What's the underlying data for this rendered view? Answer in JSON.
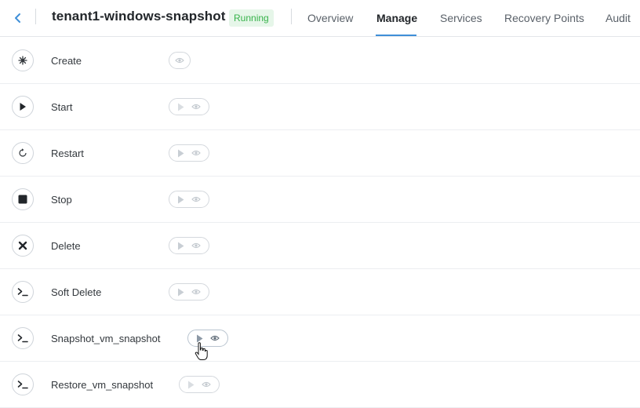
{
  "header": {
    "title": "tenant1-windows-snapshot",
    "status": "Running",
    "accent_color": "#3f8fd8",
    "status_color": "#36b24a",
    "tabs": [
      {
        "label": "Overview",
        "active": false
      },
      {
        "label": "Manage",
        "active": true
      },
      {
        "label": "Services",
        "active": false
      },
      {
        "label": "Recovery Points",
        "active": false
      },
      {
        "label": "Audit",
        "active": false
      }
    ]
  },
  "actions": [
    {
      "label": "Create",
      "icon": "sparkle-icon",
      "buttons": [
        "view"
      ],
      "enabled": true
    },
    {
      "label": "Start",
      "icon": "play-icon",
      "buttons": [
        "run",
        "view"
      ],
      "enabled": false
    },
    {
      "label": "Restart",
      "icon": "restart-icon",
      "buttons": [
        "run",
        "view"
      ],
      "enabled": false
    },
    {
      "label": "Stop",
      "icon": "stop-icon",
      "buttons": [
        "run",
        "view"
      ],
      "enabled": false
    },
    {
      "label": "Delete",
      "icon": "close-icon",
      "buttons": [
        "run",
        "view"
      ],
      "enabled": false
    },
    {
      "label": "Soft Delete",
      "icon": "terminal-icon",
      "buttons": [
        "run",
        "view"
      ],
      "enabled": false
    },
    {
      "label": "Snapshot_vm_snapshot",
      "icon": "terminal-icon",
      "buttons": [
        "run",
        "view"
      ],
      "enabled": true
    },
    {
      "label": "Restore_vm_snapshot",
      "icon": "terminal-icon",
      "buttons": [
        "run",
        "view"
      ],
      "enabled": false
    }
  ]
}
